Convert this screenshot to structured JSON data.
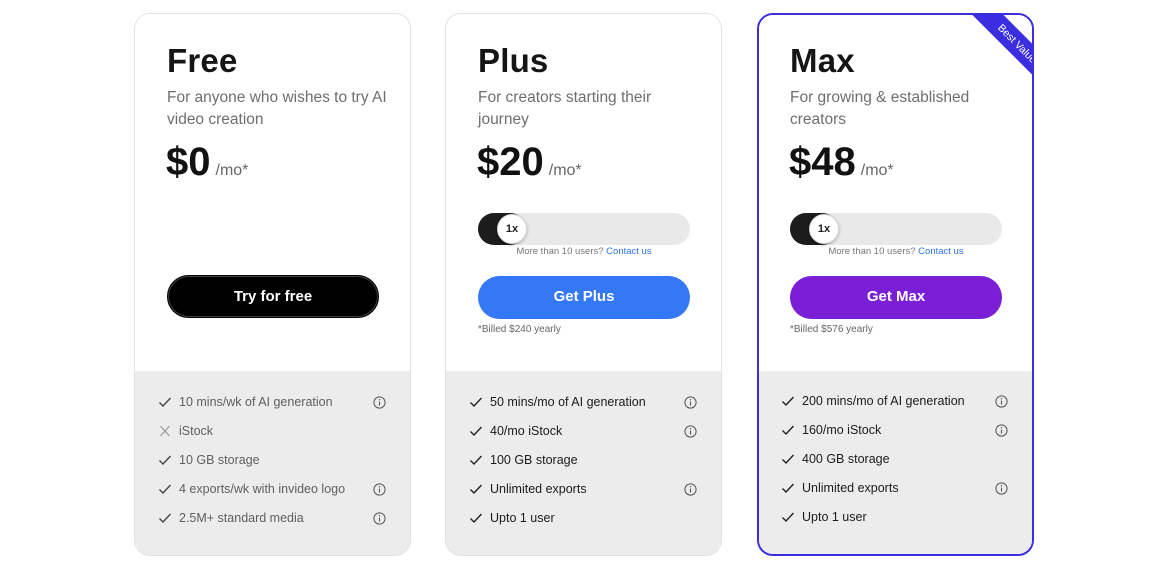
{
  "plans": [
    {
      "name": "Free",
      "description": "For anyone who wishes to try AI video creation",
      "price": "$0",
      "period": "/mo*",
      "button_label": "Try for free",
      "features": [
        {
          "text": "10 mins/wk of AI generation",
          "included": true,
          "info": true
        },
        {
          "text": "iStock",
          "included": false,
          "info": false
        },
        {
          "text": "10 GB storage",
          "included": true,
          "info": false
        },
        {
          "text": "4 exports/wk with invideo logo",
          "included": true,
          "info": true
        },
        {
          "text": "2.5M+ standard media",
          "included": true,
          "info": true
        }
      ]
    },
    {
      "name": "Plus",
      "description": "For creators starting their journey",
      "price": "$20",
      "period": "/mo*",
      "slider_value": "1x",
      "users_note": "More than 10 users?",
      "contact_link": "Contact us",
      "button_label": "Get Plus",
      "billed_note": "*Billed $240 yearly",
      "features": [
        {
          "text": "50 mins/mo of AI generation",
          "included": true,
          "info": true
        },
        {
          "text": "40/mo iStock",
          "included": true,
          "info": true
        },
        {
          "text": "100 GB storage",
          "included": true,
          "info": false
        },
        {
          "text": "Unlimited exports",
          "included": true,
          "info": true
        },
        {
          "text": "Upto 1 user",
          "included": true,
          "info": false
        }
      ]
    },
    {
      "name": "Max",
      "badge": "Best Value",
      "description": "For growing & established creators",
      "price": "$48",
      "period": "/mo*",
      "slider_value": "1x",
      "users_note": "More than 10 users?",
      "contact_link": "Contact us",
      "button_label": "Get Max",
      "billed_note": "*Billed $576 yearly",
      "features": [
        {
          "text": "200 mins/mo of AI generation",
          "included": true,
          "info": true
        },
        {
          "text": "160/mo iStock",
          "included": true,
          "info": true
        },
        {
          "text": "400 GB storage",
          "included": true,
          "info": false
        },
        {
          "text": "Unlimited exports",
          "included": true,
          "info": true
        },
        {
          "text": "Upto 1 user",
          "included": true,
          "info": false
        }
      ]
    }
  ],
  "colors": {
    "plus_button": "#3478f6",
    "max_button": "#7a1fd6",
    "max_border": "#3b2ee0",
    "link": "#2f74e8",
    "features_bg": "#ececec"
  }
}
